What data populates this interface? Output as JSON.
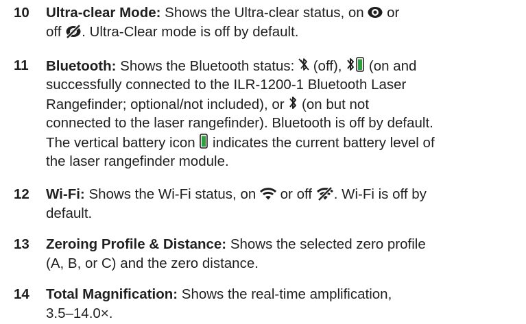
{
  "items": [
    {
      "number": "10",
      "term": "Ultra-clear Mode:",
      "l1a": " Shows the Ultra-clear status, on ",
      "l1b": " or",
      "l2a": "off ",
      "l2b": ". Ultra-Clear mode is off by default.",
      "icons": [
        "eye-icon",
        "eye-off-icon"
      ]
    },
    {
      "number": "11",
      "term": "Bluetooth:",
      "l1a": " Shows the Bluetooth status: ",
      "l1b": " (off), ",
      "l1c": " (on and",
      "l2": "successfully connected to the ILR-1200-1 Bluetooth Laser",
      "l3a": "Rangefinder; optional/not included), or ",
      "l3b": " (on but not",
      "l4": "connected to the laser rangefinder). Bluetooth is off by default.",
      "l5a": "The vertical battery icon ",
      "l5b": " indicates the current battery level of",
      "l6": "the laser rangefinder module.",
      "icons": [
        "bluetooth-off-icon",
        "bluetooth-connected-icon",
        "battery-icon",
        "bluetooth-icon"
      ],
      "battery_color": "#2e9e3e"
    },
    {
      "number": "12",
      "term": "Wi-Fi:",
      "l1a": " Shows the Wi-Fi status, on ",
      "l1b": " or off ",
      "l1c": ". Wi-Fi is off by",
      "l2": "default.",
      "icons": [
        "wifi-icon",
        "wifi-off-icon"
      ]
    },
    {
      "number": "13",
      "term": "Zeroing Profile & Distance:",
      "l1a": " Shows the selected zero profile",
      "l2": "(A, B, or C) and the zero distance."
    },
    {
      "number": "14",
      "term": "Total Magnification:",
      "l1a": " Shows the real-time amplification,",
      "l2": "3.5–14.0×."
    }
  ]
}
